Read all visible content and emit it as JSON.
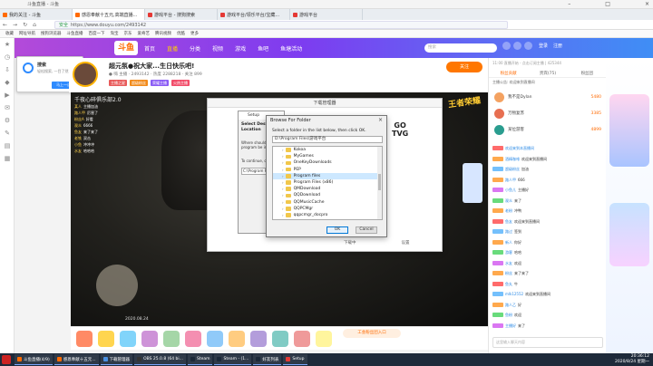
{
  "browser": {
    "window_title": "斗鱼直播 - 斗鱼",
    "tabs": [
      {
        "label": "我的关注 - 斗鱼",
        "color": "#ff6a00"
      },
      {
        "label": "感恩奉献十五元,高端直播...",
        "color": "#ff6a00",
        "active": true
      },
      {
        "label": "游戏平台 - 搜狗搜索",
        "color": "#e53935"
      },
      {
        "label": "游戏平台/领乐平台/宝藏...",
        "color": "#e53935"
      },
      {
        "label": "游戏平台",
        "color": "#e53935"
      }
    ],
    "back": "←",
    "forward": "→",
    "refresh": "↻",
    "home": "⌂",
    "url": "https://www.douyu.com/2493142",
    "url_secure_label": "安全",
    "bookmarks": [
      "收藏",
      "网址导航",
      "搜狗浏览器",
      "斗鱼直播",
      "百度一下",
      "淘宝",
      "京东",
      "爱奇艺",
      "腾讯视频",
      "优酷",
      "更多"
    ]
  },
  "left_strip": {
    "icons": [
      "star-icon",
      "history-icon",
      "download-icon",
      "game-icon",
      "video-icon",
      "mail-icon",
      "settings-icon",
      "tool-icon",
      "note-icon",
      "app-icon"
    ]
  },
  "douyu_header": {
    "logo": "斗鱼",
    "nav": [
      "首页",
      "直播",
      "分类",
      "视频",
      "游戏",
      "鱼吧",
      "鱼塘活动"
    ],
    "hot_index": 1,
    "search_placeholder": "搜索",
    "right_labels": [
      "登录",
      "注册"
    ]
  },
  "popup": {
    "title": "搜索",
    "subtitle": "轻松搜索, 一目了然",
    "button": "马上一试"
  },
  "room": {
    "title": "超元氛●祝大家...生日快乐吧!",
    "meta": "● 嗨 主播 · 2493142 · 热度 2288218 · 关注 899",
    "tags": [
      {
        "label": "主播之星",
        "color": "#e85b5b"
      },
      {
        "label": "超级粉丝",
        "color": "#f28b1b"
      },
      {
        "label": "荣耀主播",
        "color": "#8a5cf5"
      },
      {
        "label": "火热主播",
        "color": "#f24d6a"
      }
    ],
    "follow": "关注"
  },
  "video": {
    "title": "千夜心碎俱乐部2.0",
    "danmu": [
      {
        "user": "某人",
        "text": "主播加油"
      },
      {
        "user": "路人甲",
        "text": "厉害了"
      },
      {
        "user": "粉丝A",
        "text": "好看"
      },
      {
        "user": "观众",
        "text": "6666"
      },
      {
        "user": "鱼友",
        "text": "来了来了"
      },
      {
        "user": "老铁",
        "text": "双击"
      },
      {
        "user": "小鱼",
        "text": "冲冲冲"
      },
      {
        "user": "水友",
        "text": "哈哈哈"
      }
    ],
    "game_logo": "王者荣耀",
    "timestamp": "2020.08.24"
  },
  "downloader": {
    "title": "下载管理器",
    "footer_left": "下载中",
    "footer_right": "设置"
  },
  "setup_dialog": {
    "title": "Setup",
    "heading": "Select Destination Location",
    "sub": "Where should the program be installed?",
    "to_label": "To continue, click Next.",
    "path": "C:\\Program Files"
  },
  "browse_dialog": {
    "title": "Browse For Folder",
    "close": "×",
    "instruction": "Select a folder in the list below, then click OK.",
    "path": "D:\\Program Files\\游戏平台",
    "folders": [
      "Kokoa",
      "MyGames",
      "OneKeyDownloads",
      "PEP",
      "Program files",
      "Program Files (x86)",
      "QMDownload",
      "QQDownload",
      "QQMusicCache",
      "QQPCMgr",
      "qqpcmgr_docpro"
    ],
    "selected": "Program files",
    "ok": "OK",
    "cancel": "Cancel"
  },
  "gotvg": [
    "GO",
    "TVG"
  ],
  "gift_bar": {
    "entry_label": "工会粉丝团入口",
    "gift_colors": [
      "#ff8a65",
      "#ffd54f",
      "#81d4fa",
      "#ce93d8",
      "#a5d6a7",
      "#f48fb1",
      "#90caf9",
      "#ffcc80",
      "#b39ddb",
      "#80cbc4",
      "#ef9a9a",
      "#fff59d"
    ]
  },
  "right_panel": {
    "hint": "11:00 直播开始 - 点击订阅主播 | 425344",
    "tabs": [
      "粉丝贡献",
      "贵宾(75)",
      "粉丝团"
    ],
    "active_tab": 0,
    "notice": "主播公告: 欢迎来到直播间",
    "ranking": [
      {
        "name": "我不是Dylan",
        "score": "5480",
        "color": "#f4a261"
      },
      {
        "name": "万物复苏",
        "score": "3385",
        "color": "#e76f51"
      },
      {
        "name": "某位游客",
        "score": "4899",
        "color": "#2a9d8f"
      }
    ],
    "chat": [
      {
        "user": "欢迎来到本直播间",
        "text": "",
        "badge": "#ff6b6b"
      },
      {
        "user": "酒精咖啡",
        "text": "欢迎来到直播间",
        "badge": "#ffa94d"
      },
      {
        "user": "超级粉丝",
        "text": "加油",
        "badge": "#74c0fc"
      },
      {
        "user": "路人甲",
        "text": "666",
        "badge": "#ffa94d"
      },
      {
        "user": "小鱼儿",
        "text": "主播好",
        "badge": "#da77f2"
      },
      {
        "user": "观众",
        "text": "来了",
        "badge": "#69db7c"
      },
      {
        "user": "老粉",
        "text": "冲鸭",
        "badge": "#ffa94d"
      },
      {
        "user": "鱼友",
        "text": "欢迎来到直播间",
        "badge": "#ff6b6b"
      },
      {
        "user": "路过",
        "text": "签到",
        "badge": "#74c0fc"
      },
      {
        "user": "新人",
        "text": "你好",
        "badge": "#ffa94d"
      },
      {
        "user": "游客",
        "text": "哈哈",
        "badge": "#69db7c"
      },
      {
        "user": "水友",
        "text": "欢迎",
        "badge": "#da77f2"
      },
      {
        "user": "粉丝",
        "text": "来了来了",
        "badge": "#ffa94d"
      },
      {
        "user": "鱼丸",
        "text": "牛",
        "badge": "#ff6b6b"
      },
      {
        "user": "mlk12552",
        "text": "欢迎来到直播间",
        "badge": "#74c0fc"
      },
      {
        "user": "路人乙",
        "text": "好",
        "badge": "#ffa94d"
      },
      {
        "user": "鱼粉",
        "text": "欢迎",
        "badge": "#69db7c"
      },
      {
        "user": "主播好",
        "text": "来了",
        "badge": "#da77f2"
      }
    ],
    "input_placeholder": "这里输入聊天内容"
  },
  "taskbar": {
    "items": [
      {
        "label": "斗鱼直播(4/9)",
        "color": "#ff6a00"
      },
      {
        "label": "感恩奉献十五元...",
        "color": "#ff6a00"
      },
      {
        "label": "下载管理器",
        "color": "#4a90e2"
      },
      {
        "label": "OBS 25.0.8 (64 bi...",
        "color": "#333333"
      },
      {
        "label": "Steam",
        "color": "#1b2838"
      },
      {
        "label": "Steam - (1...",
        "color": "#1b2838"
      },
      {
        "label": "好友列表",
        "color": "#1b2838"
      },
      {
        "label": "Setup",
        "color": "#e53935"
      }
    ],
    "time": "20:36:12",
    "date": "2020/8/24 星期一"
  }
}
